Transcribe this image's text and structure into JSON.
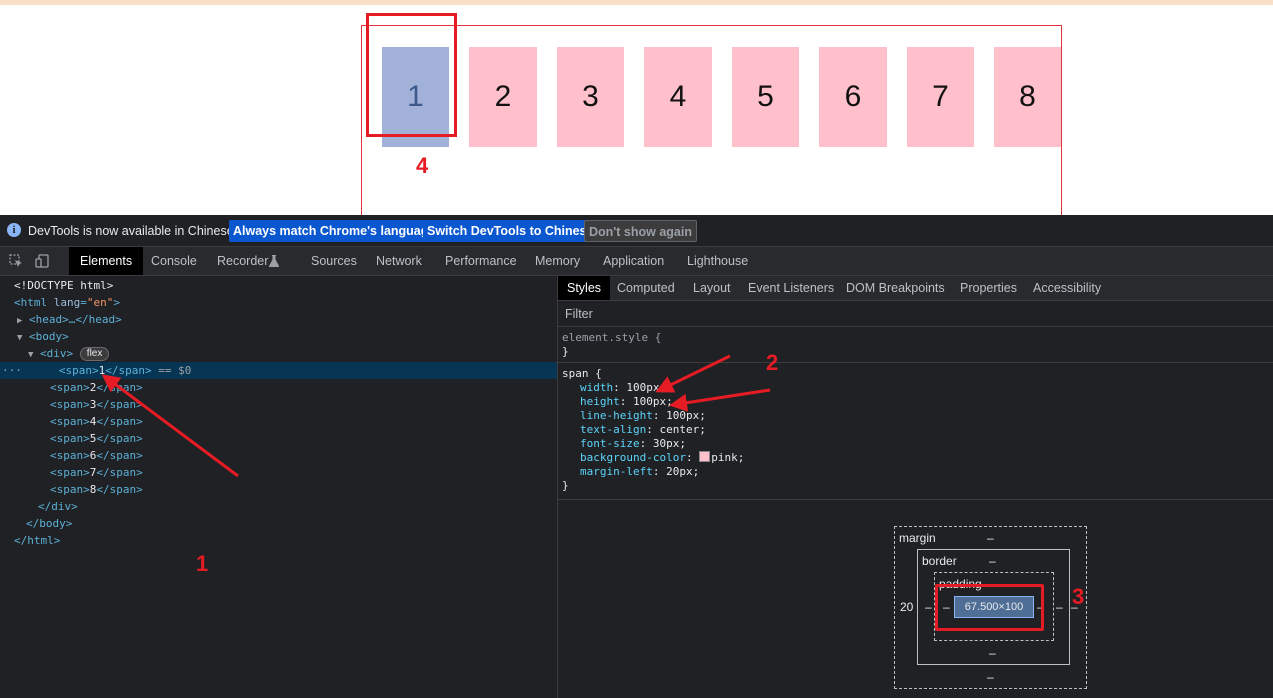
{
  "viewport": {
    "items": [
      {
        "label": "1",
        "selected": true
      },
      {
        "label": "2",
        "selected": false
      },
      {
        "label": "3",
        "selected": false
      },
      {
        "label": "4",
        "selected": false
      },
      {
        "label": "5",
        "selected": false
      },
      {
        "label": "6",
        "selected": false
      },
      {
        "label": "7",
        "selected": false
      },
      {
        "label": "8",
        "selected": false
      }
    ]
  },
  "annotations": {
    "n1": "1",
    "n2": "2",
    "n3": "3",
    "n4": "4"
  },
  "infobar": {
    "message": "DevTools is now available in Chinese!",
    "btn_match": "Always match Chrome's language",
    "btn_switch": "Switch DevTools to Chinese",
    "btn_dismiss": "Don't show again"
  },
  "tabs": [
    "Elements",
    "Console",
    "Recorder",
    "Sources",
    "Network",
    "Performance",
    "Memory",
    "Application",
    "Lighthouse"
  ],
  "tree": {
    "doctype": "<!DOCTYPE html>",
    "html_open": "<html",
    "html_attr": "lang",
    "html_val": "\"en\"",
    "head": "<head>…</head>",
    "body_open": "<body>",
    "div_open": "<div>",
    "flex_badge": "flex",
    "spans": [
      "1",
      "2",
      "3",
      "4",
      "5",
      "6",
      "7",
      "8"
    ],
    "selected_suffix": "== $0",
    "div_close": "</div>",
    "body_close": "</body>",
    "html_close": "</html>",
    "dots": "···"
  },
  "subtabs": [
    "Styles",
    "Computed",
    "Layout",
    "Event Listeners",
    "DOM Breakpoints",
    "Properties",
    "Accessibility"
  ],
  "filter_placeholder": "Filter",
  "element_style": {
    "selector": "element.style {",
    "close": "}"
  },
  "span_rule": {
    "selector": "span {",
    "props": [
      {
        "name": "width",
        "value": "100px;"
      },
      {
        "name": "height",
        "value": "100px;"
      },
      {
        "name": "line-height",
        "value": "100px;"
      },
      {
        "name": "text-align",
        "value": "center;"
      },
      {
        "name": "font-size",
        "value": "30px;"
      },
      {
        "name": "background-color",
        "value": "pink;"
      },
      {
        "name": "margin-left",
        "value": "20px;"
      }
    ],
    "close": "}",
    "swatch_color": "#ffc0cb"
  },
  "box_model": {
    "margin_label": "margin",
    "margin_top": "–",
    "margin_left": "20",
    "margin_right": "–",
    "margin_bottom": "–",
    "border_label": "border",
    "border_top": "–",
    "border_left": "–",
    "border_right": "–",
    "border_bottom": "–",
    "padding_label": "padding",
    "padding_left": "–",
    "padding_right": "–",
    "content": "67.500×100"
  },
  "colors": {
    "accent": "#e51c23",
    "pink": "#ffc0cb",
    "selected_item": "#a2b1d8",
    "devtools_bg": "#202124"
  }
}
